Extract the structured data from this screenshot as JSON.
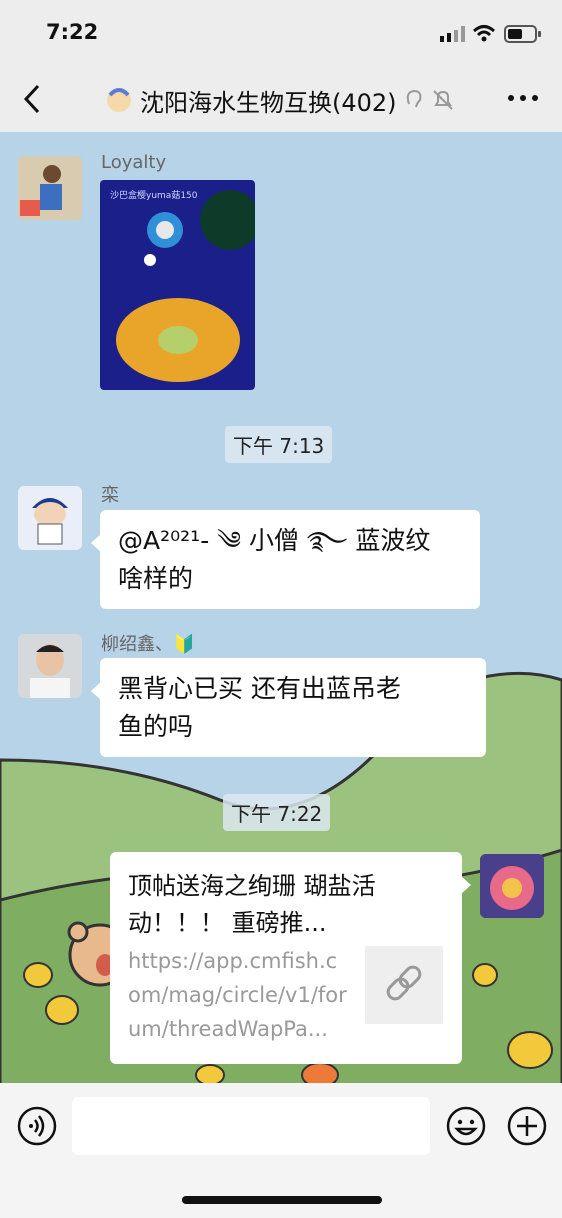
{
  "status": {
    "time": "7:22"
  },
  "nav": {
    "title": "沈阳海水生物互换(402)",
    "back_icon": "chevron-left-icon",
    "more_icon": "more-dots-icon"
  },
  "messages": [
    {
      "sender": "Loyalty",
      "type": "image",
      "image_caption": "沙巴盒樱yuma菇150"
    },
    {
      "timestamp": "下午 7:13"
    },
    {
      "sender": "栾",
      "type": "text",
      "lines": [
        "@A²⁰²¹- ༄ 小僧 ࿐ 蓝波纹",
        "啥样的"
      ]
    },
    {
      "sender": "柳绍鑫、🔰",
      "type": "text",
      "lines": [
        "黑背心已买    还有出蓝吊老",
        "鱼的吗"
      ]
    },
    {
      "timestamp": "下午 7:22"
    },
    {
      "sender": "self",
      "type": "link",
      "title": "顶帖送海之绚珊 瑚盐活动！！！ 重磅推...",
      "url": "https://app.cmfish.com/mag/circle/v1/forum/threadWapPa..."
    }
  ],
  "input": {
    "voice_icon": "voice-icon",
    "emoji_icon": "emoji-icon",
    "add_icon": "plus-icon",
    "placeholder": ""
  },
  "colors": {
    "chat_bg": "#b7d3e8",
    "hill": "#8fb573",
    "bubble": "#ffffff"
  }
}
